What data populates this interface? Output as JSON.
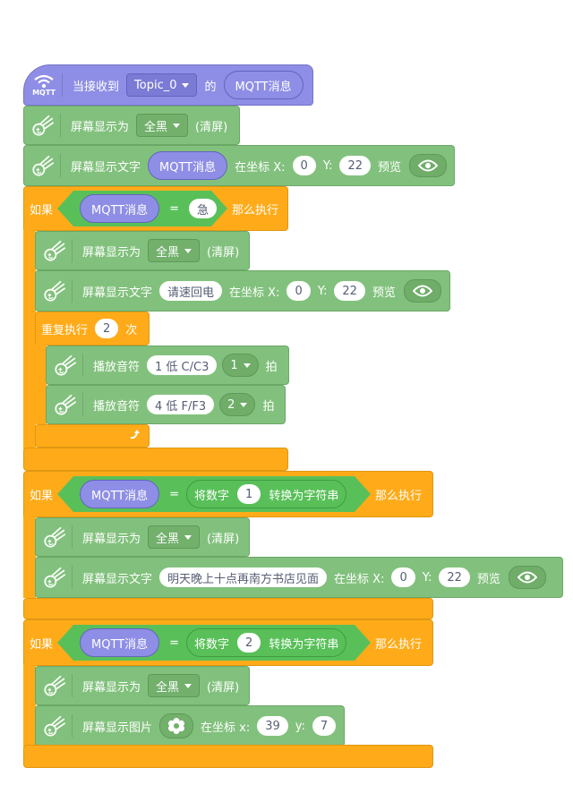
{
  "event": {
    "icon_label": "MQTT",
    "prefix": "当接收到",
    "topic": "Topic_0",
    "connector": "的",
    "reporter": "MQTT消息"
  },
  "blocks": {
    "clear1": {
      "label": "屏幕显示为",
      "color": "全黑",
      "suffix": "(清屏)"
    },
    "text1": {
      "label": "屏幕显示文字",
      "value": "MQTT消息",
      "at": "在坐标 X:",
      "x": "0",
      "ylabel": "Y:",
      "y": "22",
      "preview": "预览"
    }
  },
  "if1": {
    "if_label": "如果",
    "left": "MQTT消息",
    "op": "=",
    "right": "急",
    "then_label": "那么执行",
    "clear": {
      "label": "屏幕显示为",
      "color": "全黑",
      "suffix": "(清屏)"
    },
    "text": {
      "label": "屏幕显示文字",
      "value": "请速回电",
      "at": "在坐标 X:",
      "x": "0",
      "ylabel": "Y:",
      "y": "22",
      "preview": "预览"
    },
    "repeat": {
      "label": "重复执行",
      "count": "2",
      "suffix": "次"
    },
    "notes": [
      {
        "label": "播放音符",
        "note": "1 低 C/C3",
        "beat": "1",
        "suffix": "拍"
      },
      {
        "label": "播放音符",
        "note": "4 低 F/F3",
        "beat": "2",
        "suffix": "拍"
      }
    ]
  },
  "if2": {
    "if_label": "如果",
    "left": "MQTT消息",
    "op": "=",
    "conv_label": "将数字",
    "num": "1",
    "conv_suffix": "转换为字符串",
    "then_label": "那么执行",
    "clear": {
      "label": "屏幕显示为",
      "color": "全黑",
      "suffix": "(清屏)"
    },
    "text": {
      "label": "屏幕显示文字",
      "value": "明天晚上十点再南方书店见面",
      "at": "在坐标 X:",
      "x": "0",
      "ylabel": "Y:",
      "y": "22",
      "preview": "预览"
    }
  },
  "if3": {
    "if_label": "如果",
    "left": "MQTT消息",
    "op": "=",
    "conv_label": "将数字",
    "num": "2",
    "conv_suffix": "转换为字符串",
    "then_label": "那么执行",
    "clear": {
      "label": "屏幕显示为",
      "color": "全黑",
      "suffix": "(清屏)"
    },
    "image": {
      "label": "屏幕显示图片",
      "at": "在坐标 x:",
      "x": "39",
      "ylabel": "y:",
      "y": "7"
    }
  }
}
